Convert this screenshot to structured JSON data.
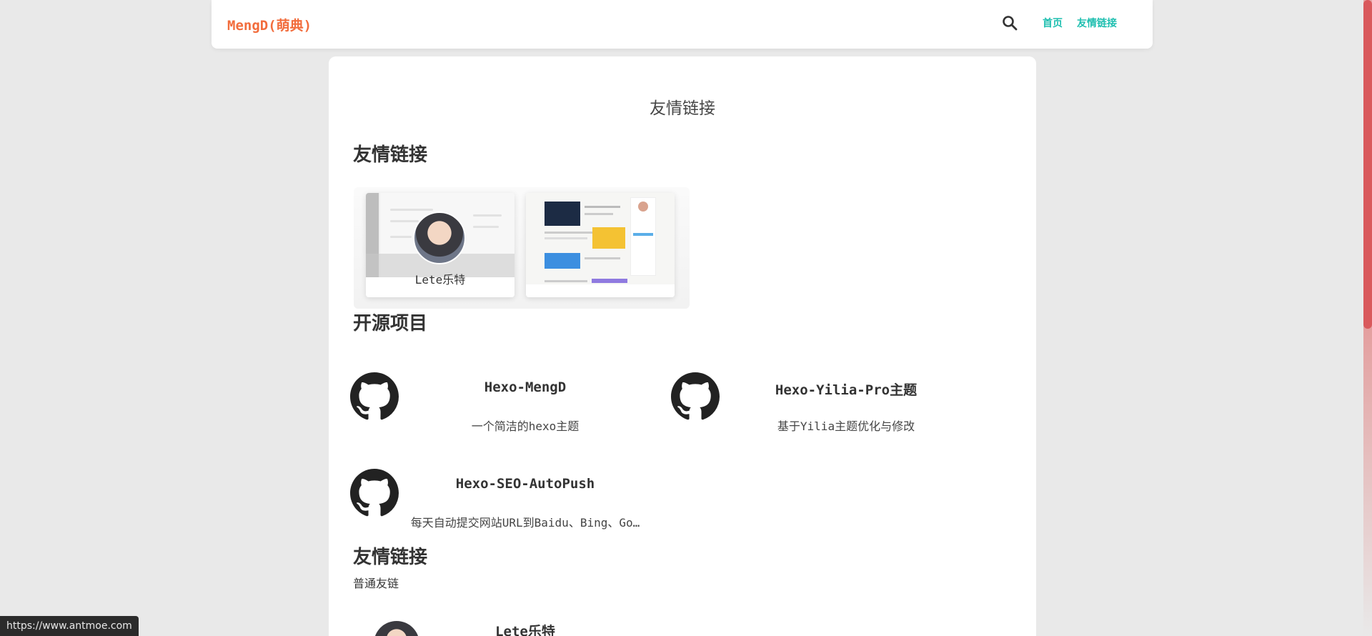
{
  "header": {
    "logo": "MengD(萌典)",
    "nav": [
      {
        "label": "首页"
      },
      {
        "label": "友情链接"
      }
    ]
  },
  "page": {
    "title": "友情链接"
  },
  "sections": {
    "friends_title": "友情链接",
    "projects_title": "开源项目",
    "friends_list_title": "友情链接",
    "friends_list_subtitle": "普通友链"
  },
  "cards": [
    {
      "name": "Lete乐特"
    }
  ],
  "projects": [
    {
      "title": "Hexo-MengD",
      "desc": "一个简洁的hexo主题"
    },
    {
      "title": "Hexo-Yilia-Pro主题",
      "desc": "基于Yilia主题优化与修改"
    },
    {
      "title": "Hexo-SEO-AutoPush",
      "desc": "每天自动提交网站URL到Baidu、Bing、Go…"
    }
  ],
  "friends": [
    {
      "name": "Lete乐特"
    }
  ],
  "status_url": "https://www.antmoe.com",
  "colors": {
    "logo": "#f26d3d",
    "nav": "#1fbfb0",
    "scrollbar": "#d9595c"
  }
}
